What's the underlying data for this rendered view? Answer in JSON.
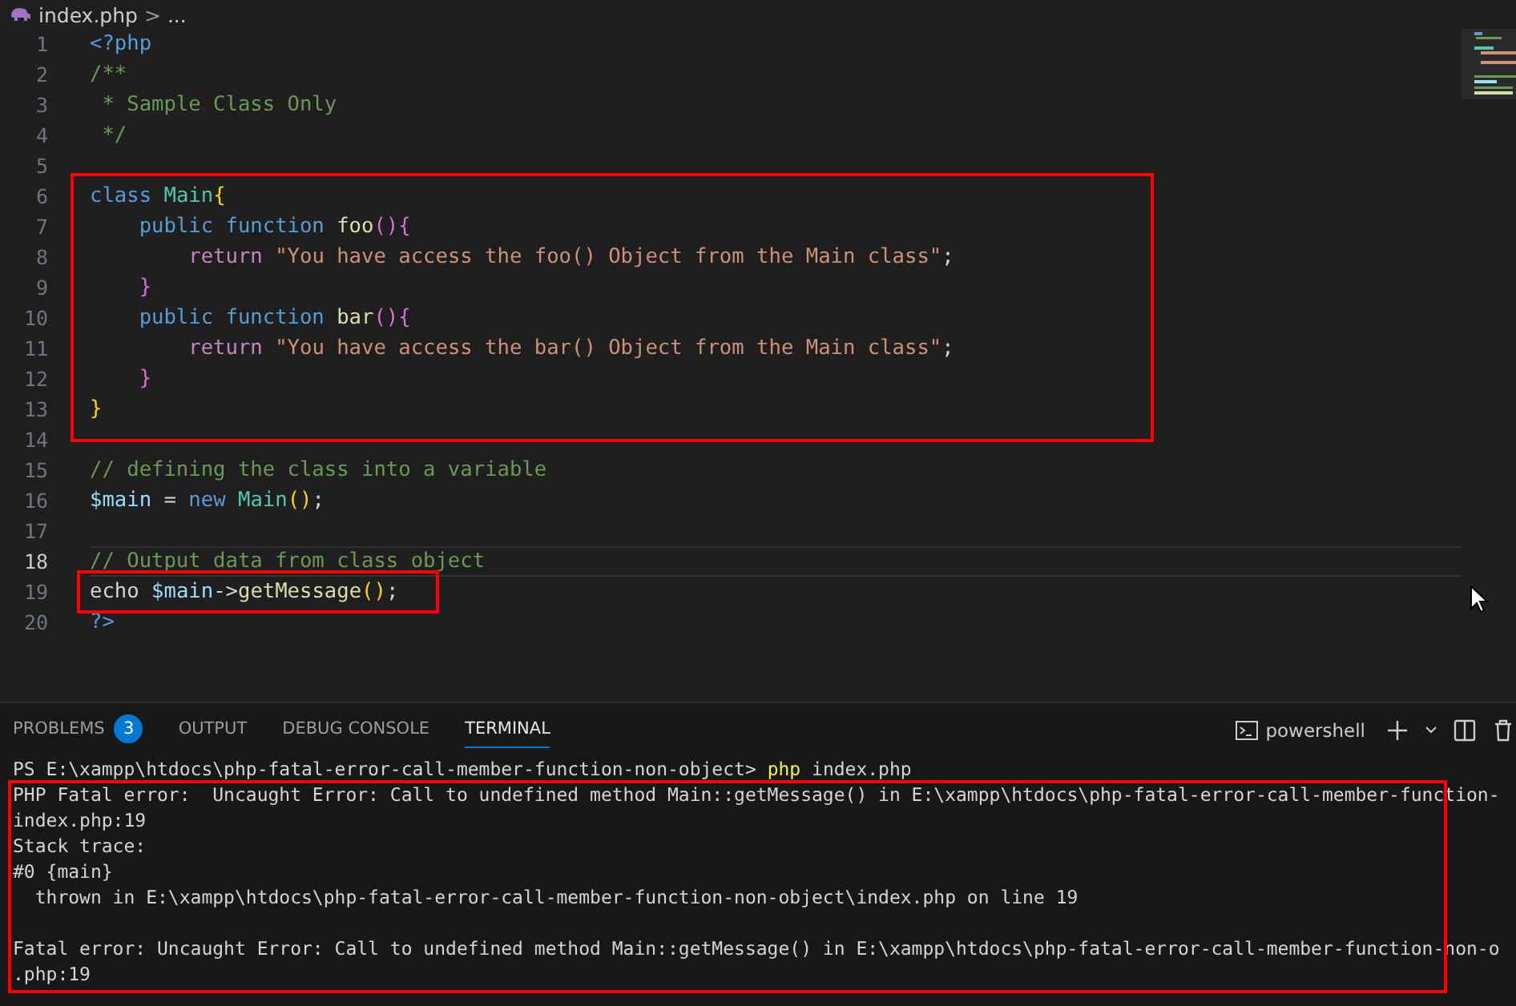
{
  "breadcrumb": {
    "file": "index.php",
    "separator": ">",
    "rest": "..."
  },
  "editor": {
    "lines": [
      {
        "number": "1",
        "current": false,
        "tokens": [
          {
            "text": "<?php",
            "kind": "tag"
          }
        ]
      },
      {
        "number": "2",
        "current": false,
        "tokens": [
          {
            "text": "/**",
            "kind": "comment"
          }
        ]
      },
      {
        "number": "3",
        "current": false,
        "tokens": [
          {
            "text": " * Sample Class Only",
            "kind": "comment"
          }
        ]
      },
      {
        "number": "4",
        "current": false,
        "tokens": [
          {
            "text": " */",
            "kind": "comment"
          }
        ]
      },
      {
        "number": "5",
        "current": false
      },
      {
        "number": "6",
        "current": false,
        "tokens": [
          {
            "text": "class ",
            "kind": "storage"
          },
          {
            "text": "Main",
            "kind": "type"
          },
          {
            "text": "{",
            "kind": "bracket1"
          }
        ]
      },
      {
        "number": "7",
        "current": false,
        "tokens": [
          {
            "text": "    public function ",
            "kind": "storage"
          },
          {
            "text": "foo",
            "kind": "func"
          },
          {
            "text": "(){",
            "kind": "bracket2"
          }
        ]
      },
      {
        "number": "8",
        "current": false,
        "tokens": [
          {
            "text": "        return ",
            "kind": "control"
          },
          {
            "text": "\"You have access the foo() Object from the Main class\"",
            "kind": "string"
          },
          {
            "text": ";",
            "kind": "plain"
          }
        ]
      },
      {
        "number": "9",
        "current": false,
        "tokens": [
          {
            "text": "    }",
            "kind": "bracket2"
          }
        ]
      },
      {
        "number": "10",
        "current": false,
        "tokens": [
          {
            "text": "    public function ",
            "kind": "storage"
          },
          {
            "text": "bar",
            "kind": "func"
          },
          {
            "text": "(){",
            "kind": "bracket2"
          }
        ]
      },
      {
        "number": "11",
        "current": false,
        "tokens": [
          {
            "text": "        return ",
            "kind": "control"
          },
          {
            "text": "\"You have access the bar() Object from the Main class\"",
            "kind": "string"
          },
          {
            "text": ";",
            "kind": "plain"
          }
        ]
      },
      {
        "number": "12",
        "current": false,
        "tokens": [
          {
            "text": "    }",
            "kind": "bracket2"
          }
        ]
      },
      {
        "number": "13",
        "current": false,
        "tokens": [
          {
            "text": "}",
            "kind": "bracket1"
          }
        ]
      },
      {
        "number": "14",
        "current": false
      },
      {
        "number": "15",
        "current": false,
        "tokens": [
          {
            "text": "// defining the class into a variable",
            "kind": "comment"
          }
        ]
      },
      {
        "number": "16",
        "current": false,
        "tokens": [
          {
            "text": "$main",
            "kind": "var"
          },
          {
            "text": " = ",
            "kind": "plain"
          },
          {
            "text": "new ",
            "kind": "storage"
          },
          {
            "text": "Main",
            "kind": "type"
          },
          {
            "text": "()",
            "kind": "bracket1"
          },
          {
            "text": ";",
            "kind": "plain"
          }
        ]
      },
      {
        "number": "17",
        "current": false
      },
      {
        "number": "18",
        "current": true,
        "tokens": [
          {
            "text": "// Output data from class object",
            "kind": "comment"
          }
        ]
      },
      {
        "number": "19",
        "current": false,
        "tokens": [
          {
            "text": "echo ",
            "kind": "plain"
          },
          {
            "text": "$main",
            "kind": "var"
          },
          {
            "text": "->",
            "kind": "plain"
          },
          {
            "text": "getMessage",
            "kind": "func"
          },
          {
            "text": "()",
            "kind": "bracket1"
          },
          {
            "text": ";",
            "kind": "plain"
          }
        ]
      },
      {
        "number": "20",
        "current": false,
        "tokens": [
          {
            "text": "?>",
            "kind": "tag"
          }
        ]
      }
    ]
  },
  "panel": {
    "tabs": [
      {
        "label": "PROBLEMS",
        "badge": "3",
        "selected": false
      },
      {
        "label": "OUTPUT",
        "selected": false
      },
      {
        "label": "DEBUG CONSOLE",
        "selected": false
      },
      {
        "label": "TERMINAL",
        "selected": true
      }
    ],
    "shell": "powershell",
    "terminal_lines": [
      {
        "kind": "output",
        "segments": [
          {
            "text": "PS E:\\xampp\\htdocs\\php-fatal-error-call-member-function-non-object> ",
            "kind": "plain"
          },
          {
            "text": "php",
            "kind": "command"
          },
          {
            "text": " index.php",
            "kind": "plain"
          }
        ]
      },
      {
        "kind": "output",
        "segments": [
          {
            "text": "PHP Fatal error:  Uncaught Error: Call to undefined method Main::getMessage() in E:\\xampp\\htdocs\\php-fatal-error-call-member-function-",
            "kind": "plain"
          }
        ]
      },
      {
        "kind": "output",
        "segments": [
          {
            "text": "index.php:19",
            "kind": "plain"
          }
        ]
      },
      {
        "kind": "output",
        "segments": [
          {
            "text": "Stack trace:",
            "kind": "plain"
          }
        ]
      },
      {
        "kind": "output",
        "segments": [
          {
            "text": "#0 {main}",
            "kind": "plain"
          }
        ]
      },
      {
        "kind": "output",
        "segments": [
          {
            "text": "  thrown in E:\\xampp\\htdocs\\php-fatal-error-call-member-function-non-object\\index.php on line 19",
            "kind": "plain"
          }
        ]
      },
      {
        "kind": "blank"
      },
      {
        "kind": "output",
        "segments": [
          {
            "text": "Fatal error: Uncaught Error: Call to undefined method Main::getMessage() in E:\\xampp\\htdocs\\php-fatal-error-call-member-function-non-o",
            "kind": "plain"
          }
        ]
      },
      {
        "kind": "output",
        "segments": [
          {
            "text": ".php:19",
            "kind": "plain"
          }
        ]
      }
    ]
  }
}
